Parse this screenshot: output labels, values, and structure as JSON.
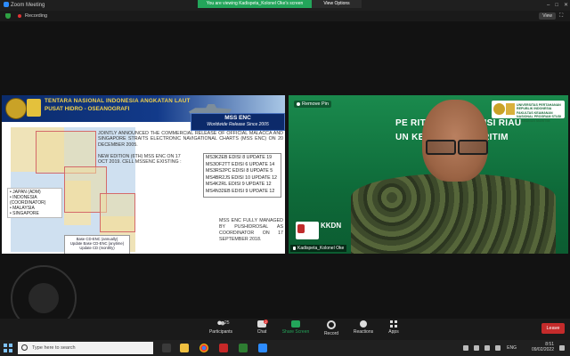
{
  "titlebar": {
    "app_title": "Zoom Meeting",
    "share_banner": "You are viewing Kadispeta_Kolonel Oke's screen",
    "view_options": "View Options",
    "view_button": "View"
  },
  "recording": {
    "label": "Recording"
  },
  "slide": {
    "header_line1": "TENTARA NASIONAL INDONESIA ANGKATAN LAUT",
    "header_line2": "PUSAT HIDRO - OSEANOGRAFI",
    "banner_title": "MSS ENC",
    "banner_subtitle": "Worldwide Release Since 2005",
    "para1": "JOINTLY ANNOUNCED THE COMMERCIAL RELEASE OF OFFICIAL MALACCA AND SINGAPORE STRAITS ELECTRONIC NAVIGATIONAL CHARTS (MSS ENC) ON 20 DECEMBER 2005.",
    "para2": "NEW EDITION (6TH) MSS ENC ON 17 OCT 2019. CELL MSSENC EXISTING :",
    "updates": [
      "MS3K2EB EDISI 8 UPDATE 19",
      "MS3OF2TT EDISI 6 UPDATE 14",
      "MS3RS2PC EDISI 8 UPDATE 5",
      "MS4BR2JS EDISI 10 UPDATE 12",
      "MS4K2RL EDISI 9 UPDATE 12",
      "MS4N32EB EDISI 9 UPDATE 12"
    ],
    "countries": [
      "JAPAN (ADM)",
      "INDONESIA (COORDINATOR)",
      "MALAYSIA",
      "SINGAPORE"
    ],
    "cid_lines": [
      "Base CD-ENC (annually)",
      "Update Base CD-ENC (anytime)",
      "Update CD (monthly)"
    ],
    "managed": "MSS ENC FULLY MANAGED BY PUSHIDROSAL AS COORDINATOR ON 17 SEPTEMBER 2018."
  },
  "camera": {
    "remove_pin": "Remove Pin",
    "logos_text": "UNIVERSITAS PERTAHANAN REPUBLIK INDONESIA FAKULTAS KEAMANAN NASIONAL PROGRAM STUDI KEAMANAN MARITIM",
    "banner_line1": "PE                  RITIM DI PROVINSI RIAU",
    "banner_line2": "UN                  KEAMANAN MARITIM",
    "kkdn": "KKDN",
    "participant_name": "Kadispeta_Kolonel Oke"
  },
  "toolbar": {
    "participants_label": "Participants",
    "participants_count": "25",
    "chat_label": "Chat",
    "chat_badge": "2",
    "share_label": "Share Screen",
    "record_label": "Record",
    "reactions_label": "Reactions",
    "apps_label": "Apps",
    "leave_label": "Leave"
  },
  "taskbar": {
    "search_placeholder": "Type here to search",
    "lang": "ENG",
    "time": "8:51",
    "date": "09/02/2022"
  },
  "colors": {
    "share_green": "#23a55a",
    "leave_red": "#c42b2b",
    "cam_green": "#0f6a3a"
  }
}
